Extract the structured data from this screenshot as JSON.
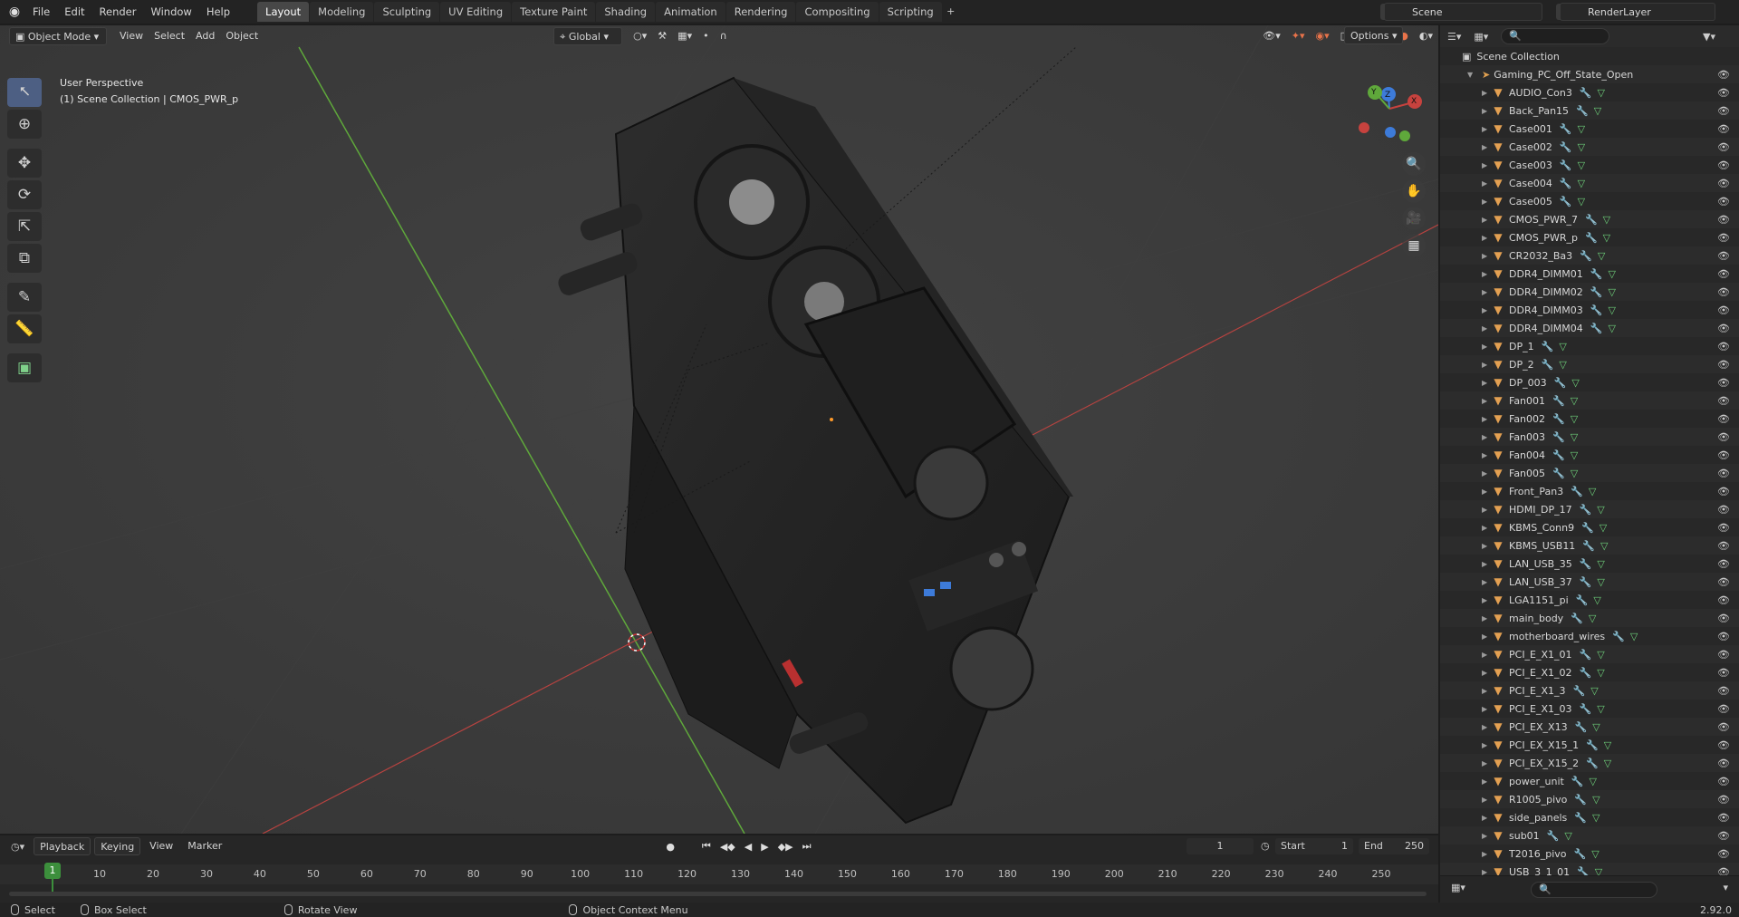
{
  "menu": [
    "File",
    "Edit",
    "Render",
    "Window",
    "Help"
  ],
  "workspaces": [
    "Layout",
    "Modeling",
    "Sculpting",
    "UV Editing",
    "Texture Paint",
    "Shading",
    "Animation",
    "Rendering",
    "Compositing",
    "Scripting"
  ],
  "active_workspace": "Layout",
  "scene_name": "Scene",
  "render_layer": "RenderLayer",
  "viewport_header": {
    "mode": "Object Mode",
    "menus": [
      "View",
      "Select",
      "Add",
      "Object"
    ],
    "orientation": "Global",
    "options": "Options"
  },
  "viewport_overlay": {
    "perspective": "User Perspective",
    "collection_info": "(1) Scene Collection | CMOS_PWR_p"
  },
  "gizmo_axes": {
    "x": "X",
    "y": "Y",
    "z": "Z"
  },
  "outliner": {
    "root": "Scene Collection",
    "collection": "Gaming_PC_Off_State_Open",
    "items": [
      "AUDIO_Con3",
      "Back_Pan15",
      "Case001",
      "Case002",
      "Case003",
      "Case004",
      "Case005",
      "CMOS_PWR_7",
      "CMOS_PWR_p",
      "CR2032_Ba3",
      "DDR4_DIMM01",
      "DDR4_DIMM02",
      "DDR4_DIMM03",
      "DDR4_DIMM04",
      "DP_1",
      "DP_2",
      "DP_003",
      "Fan001",
      "Fan002",
      "Fan003",
      "Fan004",
      "Fan005",
      "Front_Pan3",
      "HDMI_DP_17",
      "KBMS_Conn9",
      "KBMS_USB11",
      "LAN_USB_35",
      "LAN_USB_37",
      "LGA1151_pi",
      "main_body",
      "motherboard_wires",
      "PCI_E_X1_01",
      "PCI_E_X1_02",
      "PCI_E_X1_3",
      "PCI_E_X1_03",
      "PCI_EX_X13",
      "PCI_EX_X15_1",
      "PCI_EX_X15_2",
      "power_unit",
      "R1005_pivo",
      "side_panels",
      "sub01",
      "T2016_pivo",
      "USB_3_1_01"
    ]
  },
  "timeline": {
    "menus": [
      "Playback",
      "Keying",
      "View",
      "Marker"
    ],
    "current_frame": "1",
    "start_label": "Start",
    "start": "1",
    "end_label": "End",
    "end": "250",
    "ticks": [
      "10",
      "20",
      "30",
      "40",
      "50",
      "60",
      "70",
      "80",
      "90",
      "100",
      "110",
      "120",
      "130",
      "140",
      "150",
      "160",
      "170",
      "180",
      "190",
      "200",
      "210",
      "220",
      "230",
      "240",
      "250"
    ],
    "playhead": "1"
  },
  "statusbar": {
    "select": "Select",
    "box_select": "Box Select",
    "rotate_view": "Rotate View",
    "context_menu": "Object Context Menu",
    "version": "2.92.0"
  },
  "colors": {
    "accent": "#4772b3",
    "x_axis": "#c7423e",
    "y_axis": "#5fa83b",
    "z_axis": "#3d7bd9",
    "object_icon": "#e3a052",
    "mesh_icon": "#6ed07a",
    "playhead": "#3c8f3c"
  }
}
